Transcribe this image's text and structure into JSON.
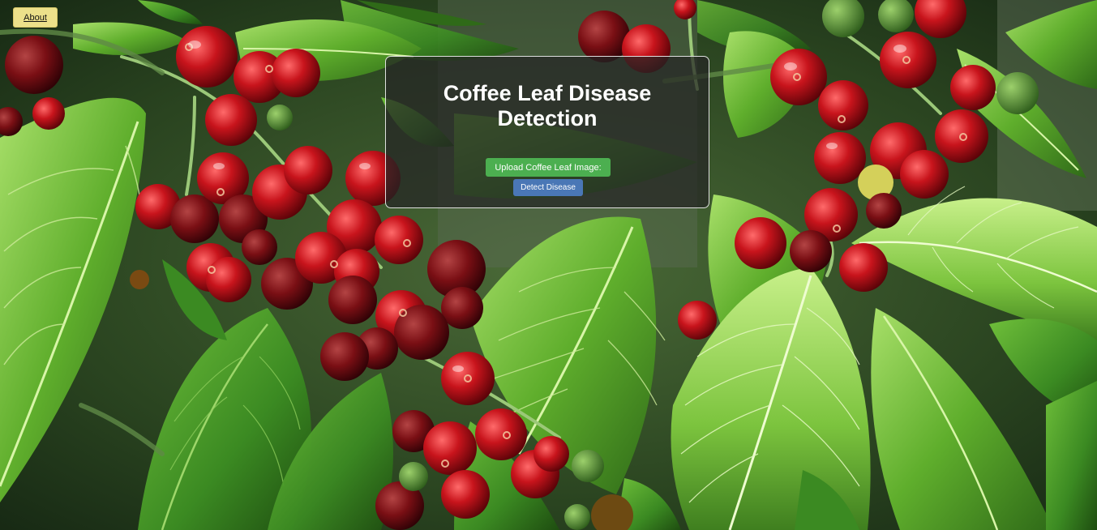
{
  "nav": {
    "about_label": "About"
  },
  "main": {
    "title": "Coffee Leaf Disease Detection",
    "upload_label": "Upload Coffee Leaf Image:",
    "detect_label": "Detect Disease"
  },
  "colors": {
    "about_button_bg": "#ece08a",
    "upload_button_bg": "#4caf50",
    "detect_button_bg": "#4a77b6",
    "panel_bg": "rgba(38,38,38,0.72)"
  },
  "background": {
    "subject": "coffee-plant-with-red-cherries-and-green-leaves"
  }
}
